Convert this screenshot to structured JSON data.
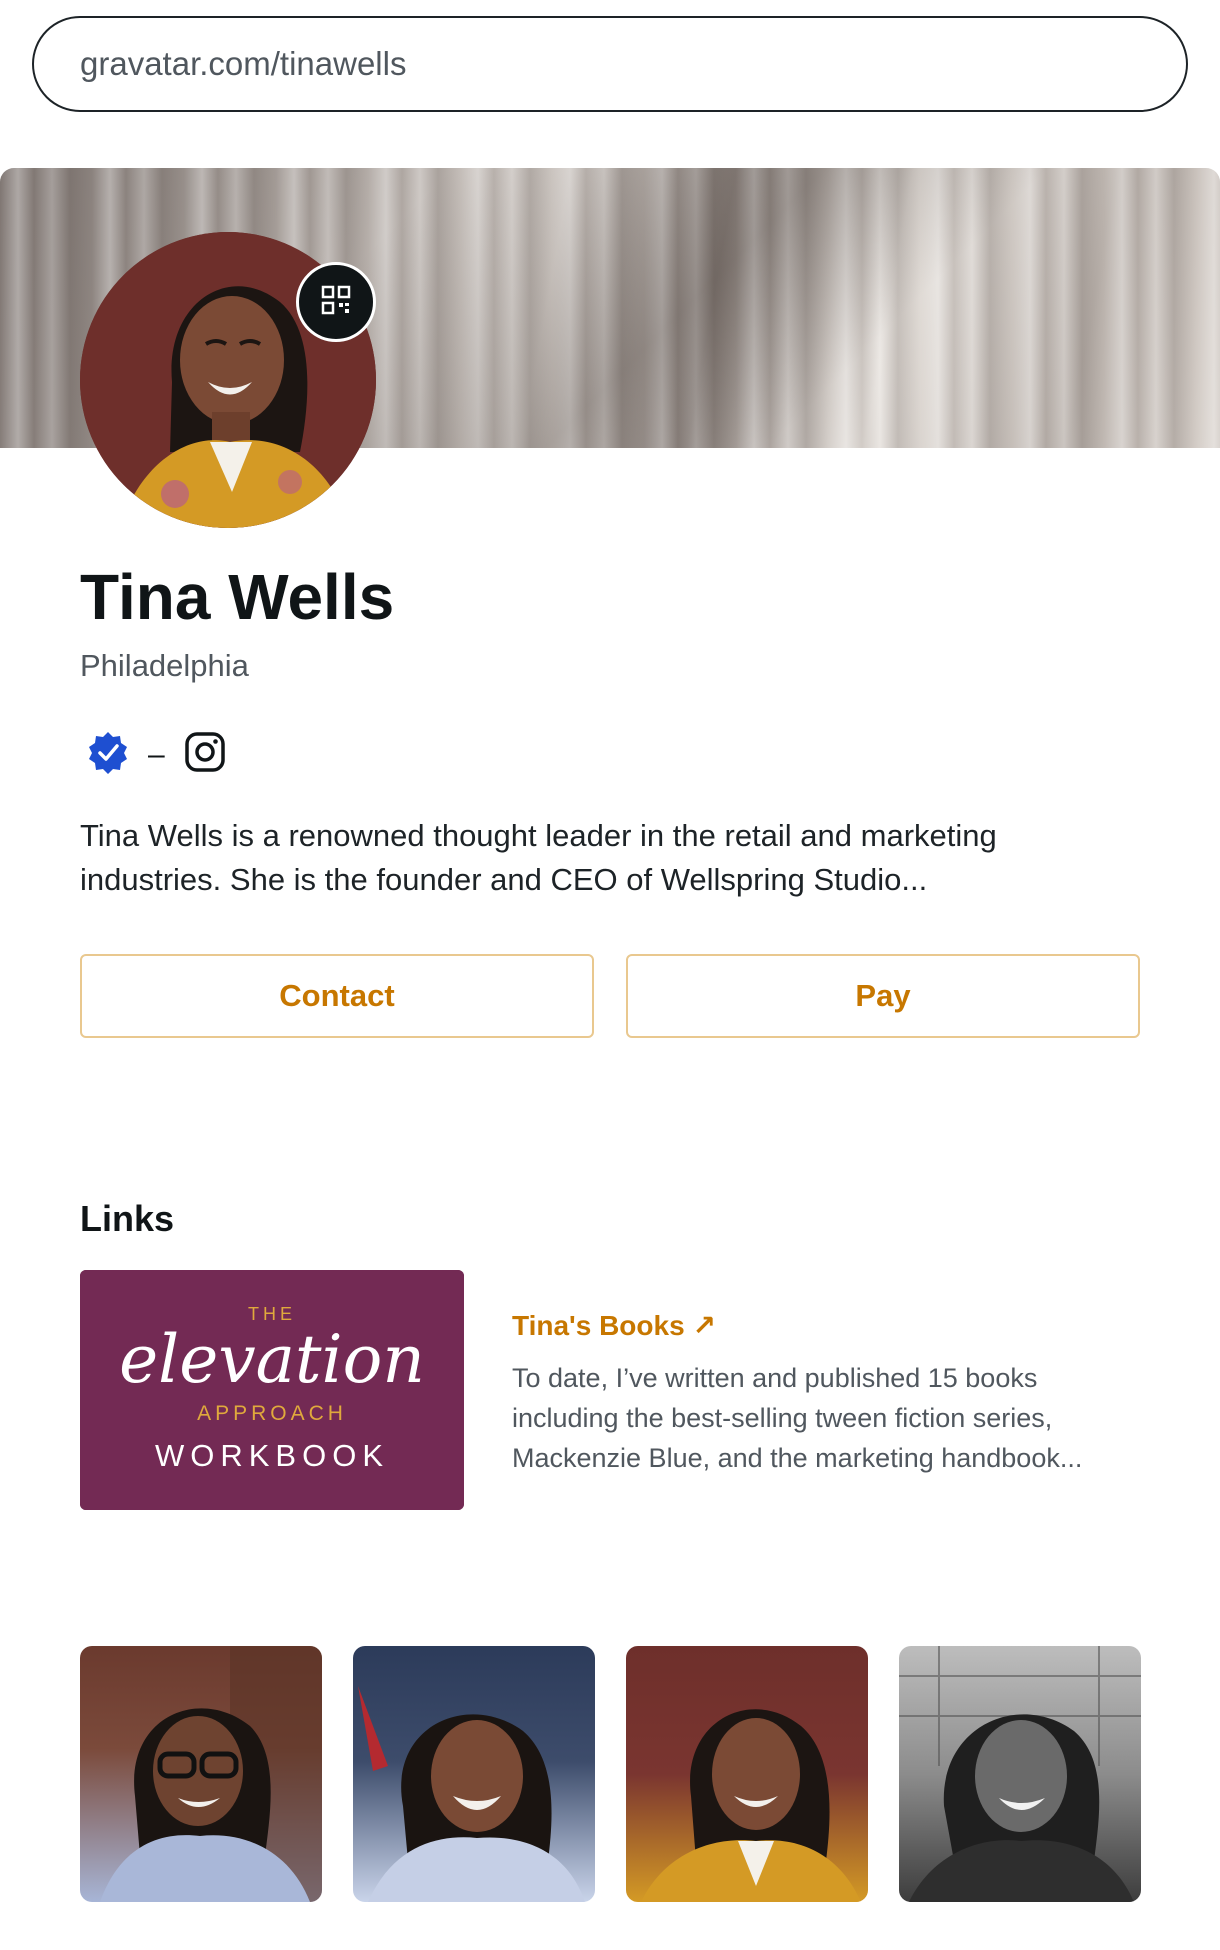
{
  "browser": {
    "url": "gravatar.com/tinawells"
  },
  "profile": {
    "name": "Tina Wells",
    "location": "Philadelphia",
    "bio_line1": "Tina Wells is a renowned thought leader in the retail and marketing",
    "bio_line2": "industries. She is the founder and CEO of Wellspring Studio...",
    "contact_label": "Contact",
    "pay_label": "Pay",
    "verified_badge_color": "#1e4fd1",
    "accent_color": "#c77700"
  },
  "links": {
    "title": "Links",
    "items": [
      {
        "thumb_top": "THE",
        "thumb_script": "elevation",
        "thumb_mid": "APPROACH",
        "thumb_bottom": "WORKBOOK",
        "title": "Tina's Books ↗",
        "desc_line1": "To date, I’ve written and published 15 books",
        "desc_line2": "including the best-selling tween fiction series,",
        "desc_line3": "Mackenzie Blue, and the marketing handbook..."
      }
    ]
  },
  "icons": [
    "qr-code-icon",
    "verified-badge-icon",
    "instagram-icon",
    "external-arrow-icon"
  ]
}
